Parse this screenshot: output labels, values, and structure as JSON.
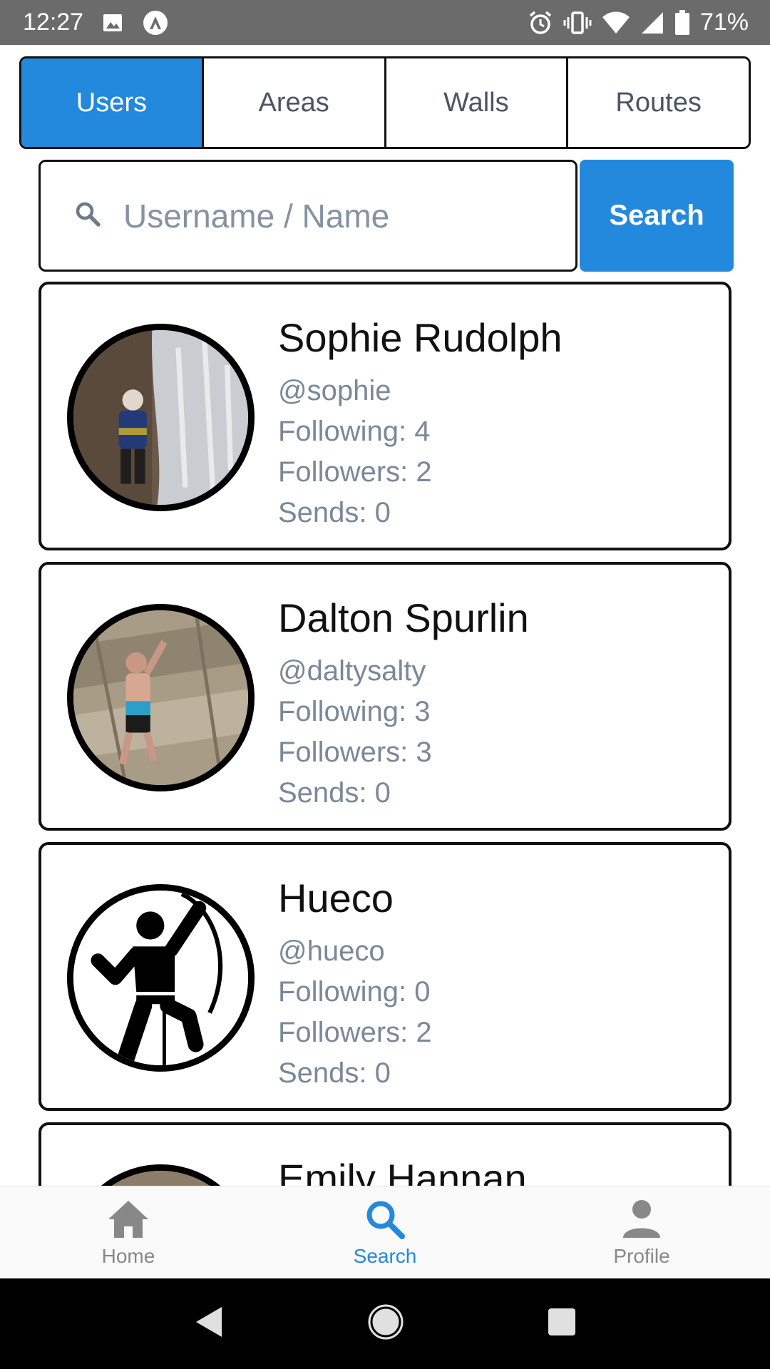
{
  "status_bar": {
    "time": "12:27",
    "battery": "71%"
  },
  "tabs": [
    {
      "label": "Users",
      "active": true
    },
    {
      "label": "Areas",
      "active": false
    },
    {
      "label": "Walls",
      "active": false
    },
    {
      "label": "Routes",
      "active": false
    }
  ],
  "search": {
    "placeholder": "Username / Name",
    "value": "",
    "button_label": "Search"
  },
  "users": [
    {
      "name": "Sophie Rudolph",
      "handle": "@sophie",
      "following": "Following: 4",
      "followers": "Followers: 2",
      "sends": "Sends: 0"
    },
    {
      "name": "Dalton Spurlin",
      "handle": "@daltysalty",
      "following": "Following: 3",
      "followers": "Followers: 3",
      "sends": "Sends: 0"
    },
    {
      "name": "Hueco",
      "handle": "@hueco",
      "following": "Following: 0",
      "followers": "Followers: 2",
      "sends": "Sends: 0"
    },
    {
      "name": "Emily Hannan",
      "handle": "",
      "following": "",
      "followers": "",
      "sends": ""
    }
  ],
  "bottom_nav": [
    {
      "label": "Home",
      "icon": "home-icon",
      "active": false
    },
    {
      "label": "Search",
      "icon": "search-icon",
      "active": true
    },
    {
      "label": "Profile",
      "icon": "profile-icon",
      "active": false
    }
  ],
  "colors": {
    "accent": "#2389dc",
    "muted_text": "#7a8898"
  }
}
